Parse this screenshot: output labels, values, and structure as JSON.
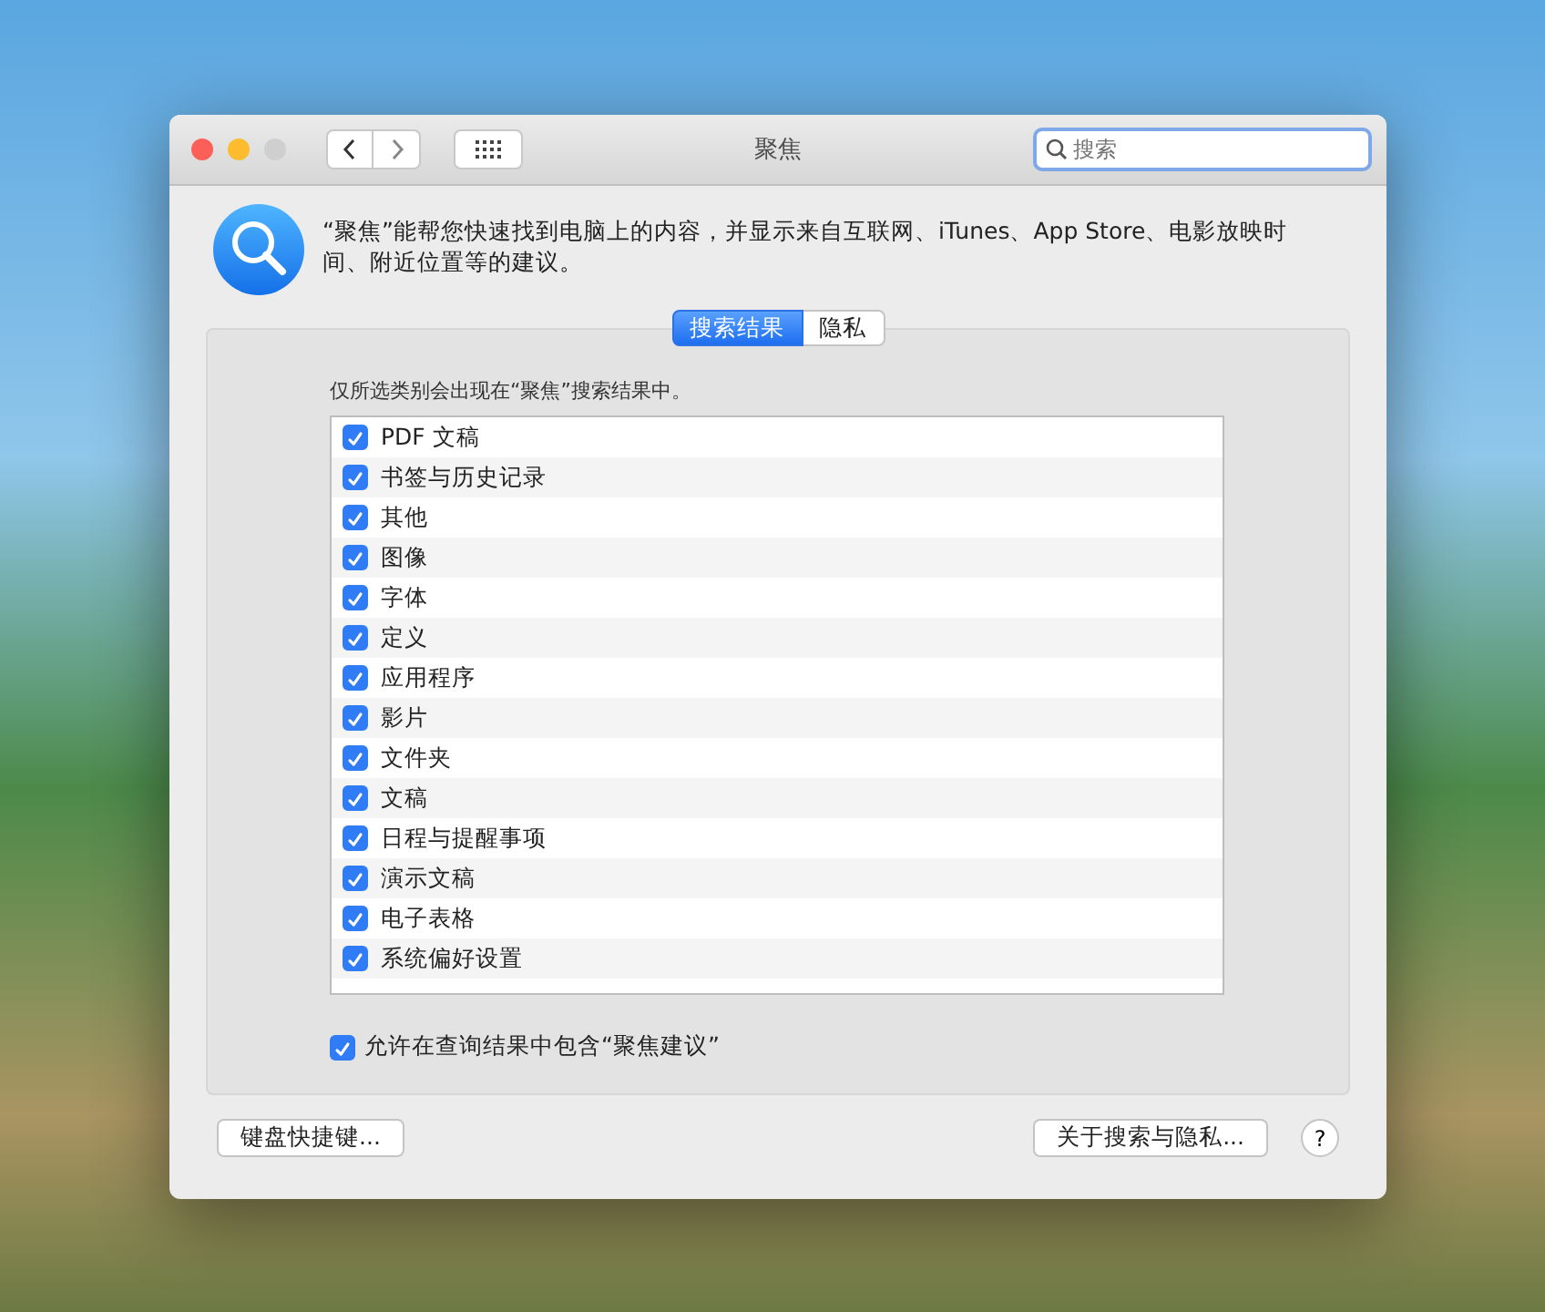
{
  "window": {
    "title": "聚焦",
    "search": {
      "placeholder": "搜索"
    }
  },
  "description": "“聚焦”能帮您快速找到电脑上的内容，并显示来自互联网、iTunes、App Store、电影放映时间、附近位置等的建议。",
  "tabs": [
    {
      "label": "搜索结果",
      "selected": true
    },
    {
      "label": "隐私",
      "selected": false
    }
  ],
  "caption": "仅所选类别会出现在“聚焦”搜索结果中。",
  "categories": [
    {
      "label": "PDF 文稿",
      "checked": true
    },
    {
      "label": "书签与历史记录",
      "checked": true
    },
    {
      "label": "其他",
      "checked": true
    },
    {
      "label": "图像",
      "checked": true
    },
    {
      "label": "字体",
      "checked": true
    },
    {
      "label": "定义",
      "checked": true
    },
    {
      "label": "应用程序",
      "checked": true
    },
    {
      "label": "影片",
      "checked": true
    },
    {
      "label": "文件夹",
      "checked": true
    },
    {
      "label": "文稿",
      "checked": true
    },
    {
      "label": "日程与提醒事项",
      "checked": true
    },
    {
      "label": "演示文稿",
      "checked": true
    },
    {
      "label": "电子表格",
      "checked": true
    },
    {
      "label": "系统偏好设置",
      "checked": true
    }
  ],
  "allow_suggestions": {
    "label": "允许在查询结果中包含“聚焦建议”",
    "checked": true
  },
  "buttons": {
    "left": "键盘快捷键...",
    "right": "关于搜索与隐私...",
    "help": "?"
  }
}
